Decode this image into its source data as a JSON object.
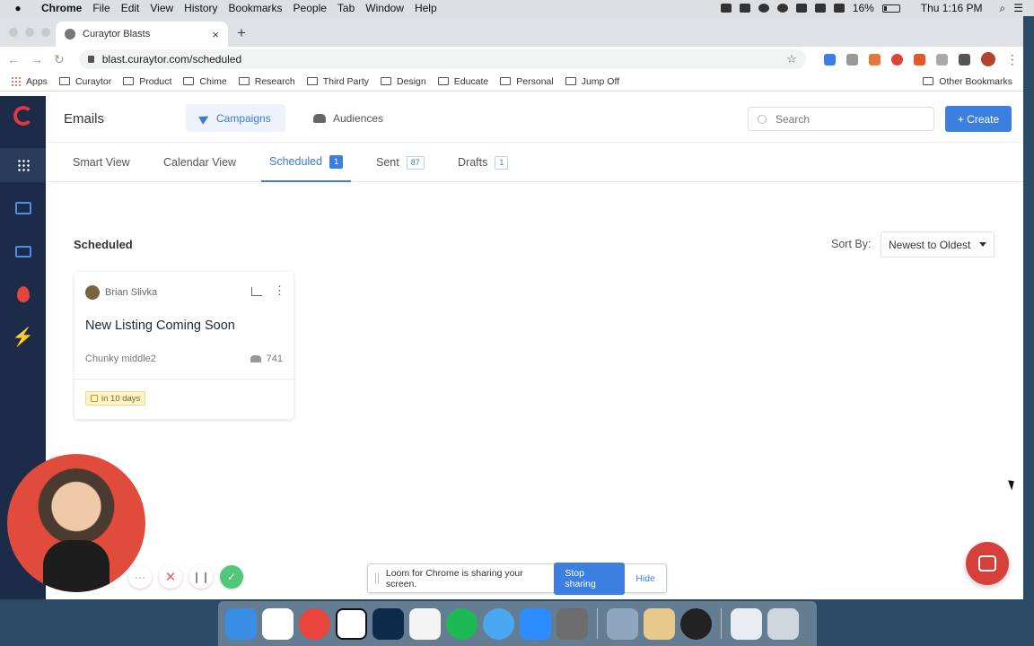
{
  "menubar": {
    "app": "Chrome",
    "items": [
      "File",
      "Edit",
      "View",
      "History",
      "Bookmarks",
      "People",
      "Tab",
      "Window",
      "Help"
    ],
    "battery": "16%",
    "clock": "Thu 1:16 PM"
  },
  "browser": {
    "tab_title": "Curaytor Blasts",
    "url": "blast.curaytor.com/scheduled",
    "bookmarks": [
      "Apps",
      "Curaytor",
      "Product",
      "Chime",
      "Research",
      "Third Party",
      "Design",
      "Educate",
      "Personal",
      "Jump Off"
    ],
    "other_bookmarks": "Other Bookmarks"
  },
  "header": {
    "title": "Emails",
    "campaigns": "Campaigns",
    "audiences": "Audiences",
    "search_placeholder": "Search",
    "create": "+ Create"
  },
  "subtabs": [
    {
      "label": "Smart View",
      "count": ""
    },
    {
      "label": "Calendar View",
      "count": ""
    },
    {
      "label": "Scheduled",
      "count": "1"
    },
    {
      "label": "Sent",
      "count": "87"
    },
    {
      "label": "Drafts",
      "count": "1"
    }
  ],
  "section": {
    "title": "Scheduled",
    "sort_label": "Sort By:",
    "sort_value": "Newest to Oldest"
  },
  "card": {
    "author": "Brian Slivka",
    "title": "New Listing Coming Soon",
    "list_name": "Chunky middle2",
    "recipients": "741",
    "due": "in 10 days"
  },
  "sharebar": {
    "message": "Loom for Chrome is sharing your screen.",
    "stop": "Stop sharing",
    "hide": "Hide"
  },
  "loom_controls": {
    "more": "···",
    "cancel": "✕",
    "pause": "❙❙",
    "done": "✓"
  },
  "colors": {
    "accent": "#3d7fe0",
    "sidebar": "#1c2b48",
    "brand_red": "#e0383e",
    "due_badge": "#fdf2c8"
  }
}
